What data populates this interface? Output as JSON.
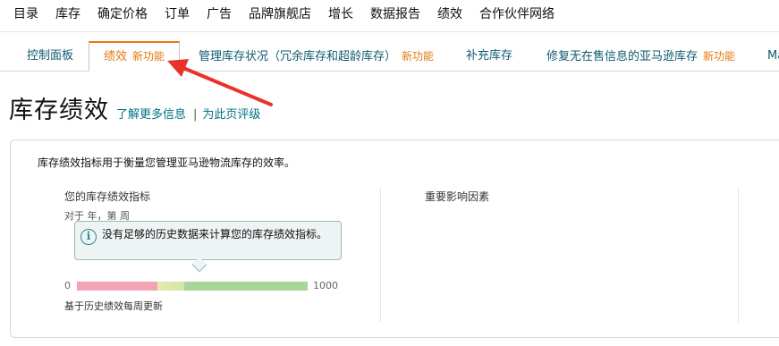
{
  "topnav": {
    "items": [
      "目录",
      "库存",
      "确定价格",
      "订单",
      "广告",
      "品牌旗舰店",
      "增长",
      "数据报告",
      "绩效",
      "合作伙伴网络"
    ]
  },
  "tabs": {
    "items": [
      {
        "label": "控制面板",
        "badge": ""
      },
      {
        "label": "绩效",
        "badge": "新功能"
      },
      {
        "label": "管理库存状况（冗余库存和超龄库存）",
        "badge": "新功能"
      },
      {
        "label": "补充库存",
        "badge": ""
      },
      {
        "label": "修复无在售信息的亚马逊库存",
        "badge": "新功能"
      },
      {
        "label": "Ma",
        "badge": ""
      }
    ],
    "active": "绩效"
  },
  "page": {
    "title": "库存绩效",
    "learn_more": "了解更多信息",
    "separator": "|",
    "rate_page": "为此页评级"
  },
  "card": {
    "intro": "库存绩效指标用于衡量您管理亚马逊物流库存的效率。",
    "metric_title": "您的库存绩效指标",
    "metric_sub": "对于 年，第 周",
    "info_text": "没有足够的历史数据来计算您的库存绩效指标。",
    "scale_min": "0",
    "scale_max": "1000",
    "footnote": "基于历史绩效每周更新",
    "factors_title": "重要影响因素"
  },
  "colors": {
    "accent": "#e47911",
    "link": "#007185",
    "arrow": "#e8332a",
    "bar_red": "#f3a3b6",
    "bar_yellow": "#e6eba9",
    "bar_green": "#a9d59b"
  }
}
